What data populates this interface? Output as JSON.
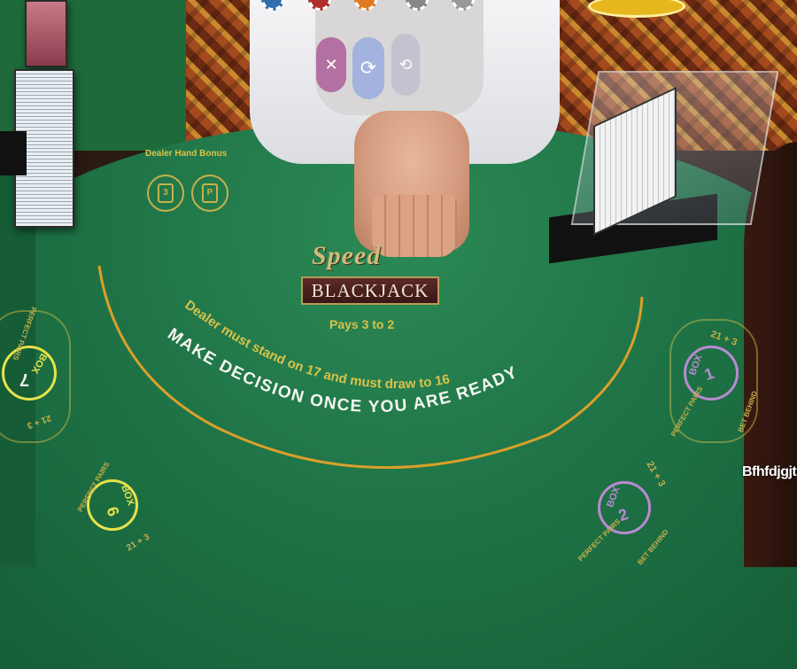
{
  "table": {
    "bonus_label": "Dealer Hand Bonus",
    "bonus_icons": [
      "3",
      "P"
    ],
    "logo_script": "Speed",
    "logo_word": "BLACKJACK",
    "payout": "Pays 3 to 2",
    "rule_text": "Dealer must stand on 17 and must draw to 16",
    "decision_text": "MAKE DECISION ONCE YOU ARE READY"
  },
  "seats": {
    "box_label": "BOX",
    "perfect_pairs": "PERFECT PAIRS",
    "side_21": "21 + 3",
    "bet_behind": "BET BEHIND",
    "seat_7": "7",
    "seat_6": "6",
    "seat_1": "1",
    "seat_2": "2"
  },
  "controls": {
    "close_icon": "close-icon",
    "refresh_icon": "refresh-icon",
    "rotate_icon": "rotate-icon"
  },
  "overlay_text": "Bfhfdjgjt",
  "colors": {
    "felt": "#1f7447",
    "gold": "#d9c24a",
    "seat_active": "#e6e24a",
    "seat_purple": "#b98ad0"
  }
}
